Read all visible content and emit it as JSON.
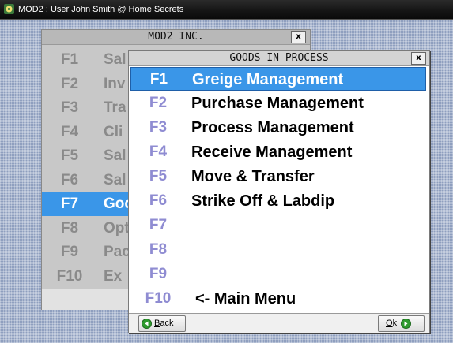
{
  "titlebar": {
    "title": "MOD2 : User John Smith @ Home Secrets"
  },
  "main_window": {
    "title": "MOD2 INC.",
    "close_label": "x",
    "items": [
      {
        "key": "F1",
        "label": "Sal"
      },
      {
        "key": "F2",
        "label": "Inv"
      },
      {
        "key": "F3",
        "label": "Tra"
      },
      {
        "key": "F4",
        "label": "Cli"
      },
      {
        "key": "F5",
        "label": "Sal"
      },
      {
        "key": "F6",
        "label": "Sal"
      },
      {
        "key": "F7",
        "label": "Goo"
      },
      {
        "key": "F8",
        "label": "Opt"
      },
      {
        "key": "F9",
        "label": "Pac"
      },
      {
        "key": "F10",
        "label": "Ex"
      }
    ],
    "selected_key": "F7"
  },
  "goods_window": {
    "title": "GOODS IN PROCESS",
    "close_label": "x",
    "items": [
      {
        "key": "F1",
        "label": "Greige Management"
      },
      {
        "key": "F2",
        "label": "Purchase Management"
      },
      {
        "key": "F3",
        "label": "Process Management"
      },
      {
        "key": "F4",
        "label": "Receive Management"
      },
      {
        "key": "F5",
        "label": "Move & Transfer"
      },
      {
        "key": "F6",
        "label": "Strike Off & Labdip"
      },
      {
        "key": "F7",
        "label": ""
      },
      {
        "key": "F8",
        "label": ""
      },
      {
        "key": "F9",
        "label": ""
      },
      {
        "key": "F10",
        "label": "<- Main Menu"
      }
    ],
    "selected_key": "F1",
    "back_button": {
      "underline": "B",
      "rest": "ack"
    },
    "ok_button": {
      "underline": "O",
      "rest": "k"
    },
    "colors": {
      "selected_bg": "#3a96e8",
      "key_color": "#8f8cd2",
      "button_icon": "#2e9a2e"
    }
  }
}
